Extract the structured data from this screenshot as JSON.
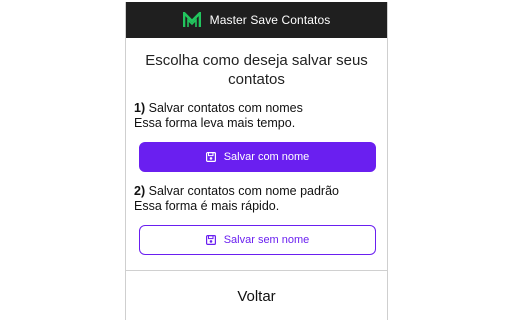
{
  "header": {
    "title": "Master Save Contatos",
    "logo_icon": "m-logo-icon",
    "logo_color": "#22c55e",
    "background": "#1f1f1f"
  },
  "heading": "Escolha como deseja salvar seus contatos",
  "option1": {
    "number": "1)",
    "title": "Salvar contatos com nomes",
    "description": "Essa forma leva mais tempo.",
    "button_label": "Salvar com nome",
    "button_icon": "floppy-disk-icon"
  },
  "option2": {
    "number": "2)",
    "title": "Salvar contatos com nome padrão",
    "description": "Essa forma é mais rápido.",
    "button_label": "Salvar sem nome",
    "button_icon": "floppy-disk-icon"
  },
  "footer": {
    "back_label": "Voltar"
  },
  "colors": {
    "accent": "#6a1ff0"
  }
}
